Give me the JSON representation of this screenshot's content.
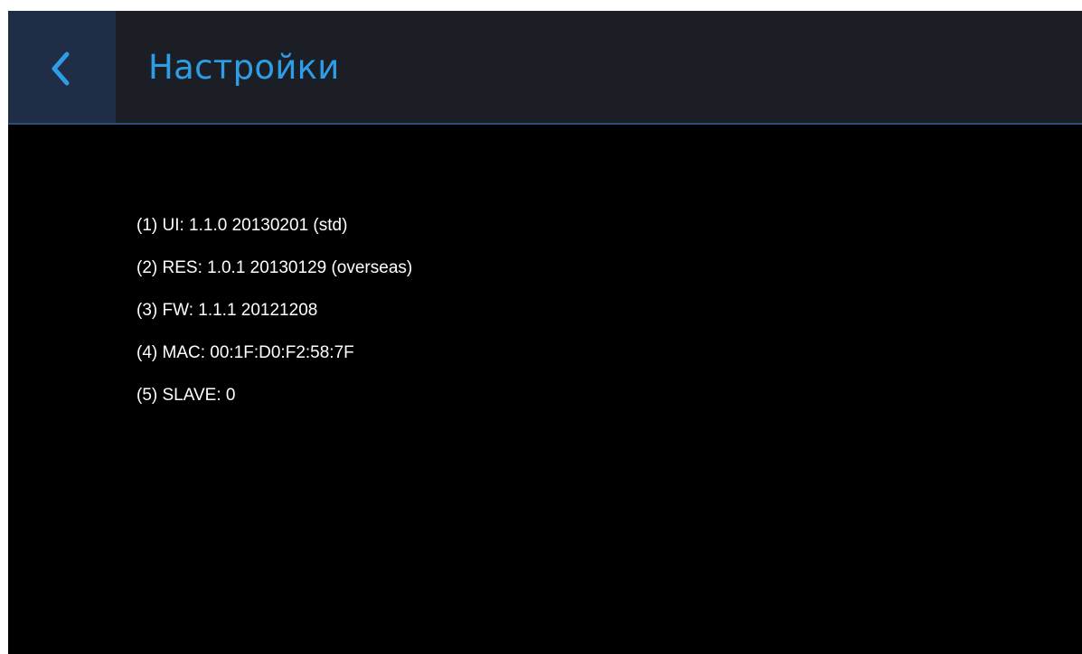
{
  "header": {
    "back_icon": "chevron-left-icon",
    "title": "Настройки"
  },
  "info": {
    "items": [
      "(1) UI: 1.1.0 20130201 (std)",
      "(2) RES: 1.0.1 20130129 (overseas)",
      "(3) FW: 1.1.1 20121208",
      "(4) MAC: 00:1F:D0:F2:58:7F",
      "(5) SLAVE: 0"
    ]
  },
  "colors": {
    "accent": "#2f9de6",
    "header_bg": "#1b1f25",
    "back_button_bg": "#1f2e46",
    "content_bg": "#000000",
    "text": "#ffffff"
  }
}
